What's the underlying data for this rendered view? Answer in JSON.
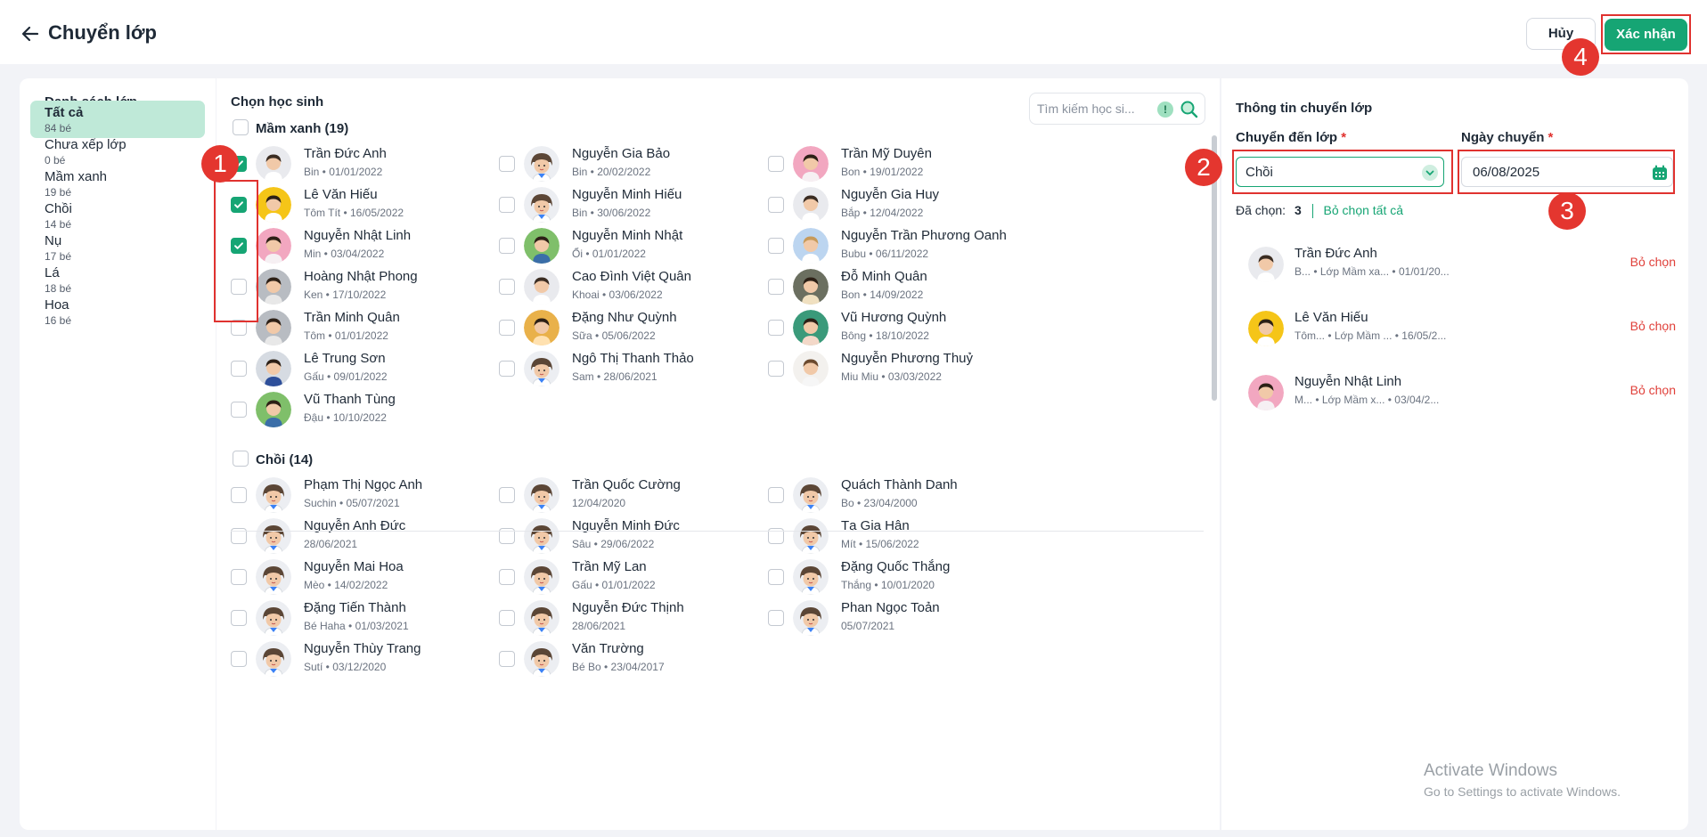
{
  "header": {
    "title": "Chuyển lớp",
    "cancel": "Hủy",
    "confirm": "Xác nhận"
  },
  "annotations": [
    "1",
    "2",
    "3",
    "4"
  ],
  "class_list": {
    "heading": "Danh sách lớp",
    "items": [
      {
        "name": "Tất cả",
        "count": "84 bé",
        "active": true
      },
      {
        "name": "Chưa xếp lớp",
        "count": "0 bé"
      },
      {
        "name": "Mầm xanh",
        "count": "19 bé"
      },
      {
        "name": "Chồi",
        "count": "14 bé"
      },
      {
        "name": "Nụ",
        "count": "17 bé"
      },
      {
        "name": "Lá",
        "count": "18 bé"
      },
      {
        "name": "Hoa",
        "count": "16 bé"
      }
    ]
  },
  "students": {
    "heading": "Chọn học sinh",
    "search_placeholder": "Tìm kiếm học si...",
    "search_badge": "!",
    "groups": [
      {
        "title": "Mầm xanh (19)",
        "students": [
          {
            "name": "Trần Đức Anh",
            "meta": "Bin  •  01/01/2022",
            "checked": true,
            "avatar": "boy-light"
          },
          {
            "name": "Nguyễn Gia Bảo",
            "meta": "Bin  •  20/02/2022",
            "avatar": "placeholder"
          },
          {
            "name": "Trần Mỹ Duyên",
            "meta": "Bon  •  19/01/2022",
            "avatar": "girl-pink"
          },
          {
            "name": "Lê Văn Hiếu",
            "meta": "Tôm Tít  •  16/05/2022",
            "checked": true,
            "avatar": "boy-yellow"
          },
          {
            "name": "Nguyễn Minh Hiếu",
            "meta": "Bin  •  30/06/2022",
            "avatar": "placeholder"
          },
          {
            "name": "Nguyễn Gia Huy",
            "meta": "Bắp  •  12/04/2022",
            "avatar": "boy-light"
          },
          {
            "name": "Nguyễn Nhật Linh",
            "meta": "Min  •  03/04/2022",
            "checked": true,
            "avatar": "girl-pink"
          },
          {
            "name": "Nguyễn Minh Nhật",
            "meta": "Ổi  •  01/01/2022",
            "avatar": "boy-green"
          },
          {
            "name": "Nguyễn Trần Phương Oanh",
            "meta": "Bubu  •  06/11/2022",
            "avatar": "girl-blue"
          },
          {
            "name": "Hoàng Nhật Phong",
            "meta": "Ken  •  17/10/2022",
            "avatar": "boy-grey"
          },
          {
            "name": "Cao Đình Việt Quân",
            "meta": "Khoai  •  03/06/2022",
            "avatar": "boy-light"
          },
          {
            "name": "Đỗ Minh Quân",
            "meta": "Bon  •  14/09/2022",
            "avatar": "boy-dark"
          },
          {
            "name": "Trần Minh Quân",
            "meta": "Tôm  •  01/01/2022",
            "avatar": "boy-grey"
          },
          {
            "name": "Đặng Như Quỳnh",
            "meta": "Sữa  •  05/06/2022",
            "avatar": "girl-yellow"
          },
          {
            "name": "Vũ Hương Quỳnh",
            "meta": "Bông  •  18/10/2022",
            "avatar": "girl-green"
          },
          {
            "name": "Lê Trung Sơn",
            "meta": "Gấu  •  09/01/2022",
            "avatar": "boy-blue"
          },
          {
            "name": "Ngô Thị Thanh Thảo",
            "meta": "Sam  •  28/06/2021",
            "avatar": "placeholder"
          },
          {
            "name": "Nguyễn Phương Thuỷ",
            "meta": "Miu Miu  •  03/03/2022",
            "avatar": "girl-light"
          },
          {
            "name": "Vũ Thanh Tùng",
            "meta": "Đậu  •  10/10/2022",
            "avatar": "boy-green"
          }
        ]
      },
      {
        "title": "Chồi (14)",
        "students": [
          {
            "name": "Phạm Thị Ngọc Anh",
            "meta": "Suchin  •  05/07/2021",
            "avatar": "placeholder"
          },
          {
            "name": "Trần Quốc Cường",
            "meta": "12/04/2020",
            "avatar": "placeholder"
          },
          {
            "name": "Quách Thành Danh",
            "meta": "Bo  •  23/04/2000",
            "avatar": "placeholder"
          },
          {
            "name": "Nguyễn Anh Đức",
            "meta": "28/06/2021",
            "avatar": "placeholder"
          },
          {
            "name": "Nguyễn Minh Đức",
            "meta": "Sâu  •  29/06/2022",
            "avatar": "placeholder"
          },
          {
            "name": "Tạ Gia Hân",
            "meta": "Mít  •  15/06/2022",
            "avatar": "placeholder"
          },
          {
            "name": "Nguyễn Mai Hoa",
            "meta": "Mèo  •  14/02/2022",
            "avatar": "placeholder"
          },
          {
            "name": "Trần Mỹ Lan",
            "meta": "Gấu  •  01/01/2022",
            "avatar": "placeholder"
          },
          {
            "name": "Đặng Quốc Thắng",
            "meta": "Thắng  •  10/01/2020",
            "avatar": "placeholder"
          },
          {
            "name": "Đặng Tiến Thành",
            "meta": "Bé Haha  •  01/03/2021",
            "avatar": "placeholder"
          },
          {
            "name": "Nguyễn Đức Thịnh",
            "meta": "28/06/2021",
            "avatar": "placeholder"
          },
          {
            "name": "Phan Ngọc Toản",
            "meta": "05/07/2021",
            "avatar": "placeholder"
          },
          {
            "name": "Nguyễn Thùy Trang",
            "meta": "Sutí  •  03/12/2020",
            "avatar": "placeholder"
          },
          {
            "name": "Văn Trường",
            "meta": "Bé Bo  •  23/04/2017",
            "avatar": "placeholder"
          }
        ]
      }
    ]
  },
  "transfer": {
    "heading": "Thông tin chuyển lớp",
    "to_class_label": "Chuyển đến lớp",
    "to_class_value": "Chồi",
    "date_label": "Ngày chuyển",
    "date_value": "06/08/2025",
    "required_mark": "*",
    "selected_label": "Đã chọn:",
    "selected_count": "3",
    "unselect_all": "Bỏ chọn tất cả",
    "chosen": [
      {
        "name": "Trần Đức Anh",
        "meta": "B...  •  Lớp Mầm xa...  •  01/01/20...",
        "avatar": "boy-light",
        "action": "Bỏ chọn"
      },
      {
        "name": "Lê Văn Hiếu",
        "meta": "Tôm...  •  Lớp Mầm ...  •  16/05/2...",
        "avatar": "boy-yellow",
        "action": "Bỏ chọn"
      },
      {
        "name": "Nguyễn Nhật Linh",
        "meta": "M...  •  Lớp Mầm x...  •  03/04/2...",
        "avatar": "girl-pink",
        "action": "Bỏ chọn"
      }
    ]
  },
  "watermark": {
    "line1": "Activate Windows",
    "line2": "Go to Settings to activate Windows."
  },
  "colors": {
    "accent": "#16a574",
    "annotation": "#e0322f",
    "danger": "#e0403a"
  }
}
